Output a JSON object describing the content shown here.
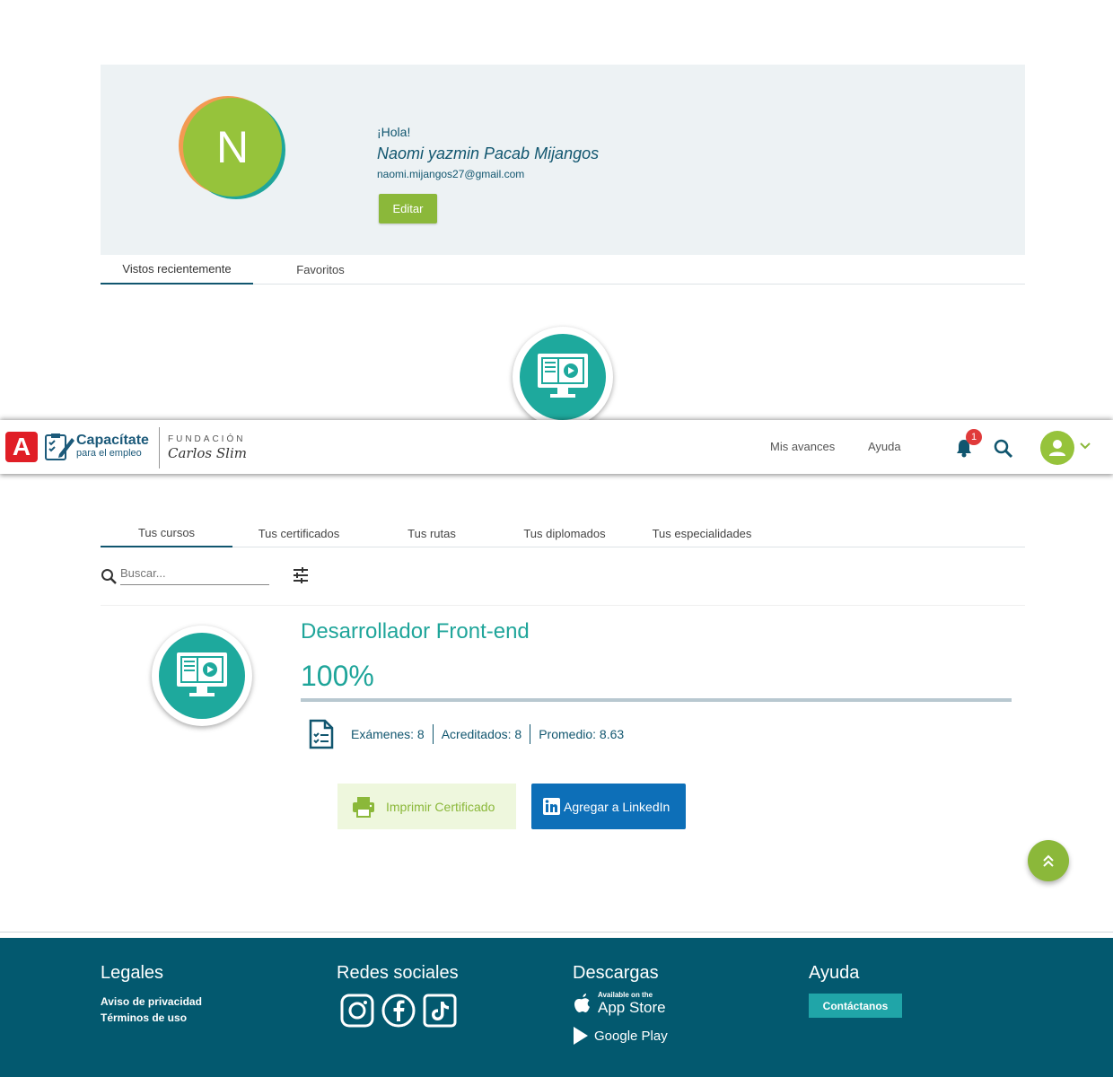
{
  "profile": {
    "avatar_letter": "N",
    "greeting": "¡Hola!",
    "name": "Naomi yazmin Pacab Mijangos",
    "email": "naomi.mijangos27@gmail.com",
    "edit_label": "Editar",
    "tabs": [
      "Vistos recientemente",
      "Favoritos"
    ]
  },
  "header": {
    "logo_letter": "A",
    "brand_title": "Capacítate",
    "brand_subtitle": "para el empleo",
    "foundation": "FUNDACIÓN",
    "foundation_name": "Carlos Slim",
    "nav": [
      "Mis avances",
      "Ayuda"
    ],
    "notification_count": "1"
  },
  "courses_tabs": [
    "Tus cursos",
    "Tus certificados",
    "Tus rutas",
    "Tus diplomados",
    "Tus especialidades"
  ],
  "search": {
    "placeholder": "Buscar..."
  },
  "course": {
    "title": "Desarrollador Front-end",
    "progress_label": "100%",
    "progress": 1.0,
    "exams": "Exámenes: 8",
    "accredited": "Acreditados: 8",
    "average": "Promedio: 8.63",
    "print_label": "Imprimir Certificado",
    "linkedin_label": "Agregar a LinkedIn"
  },
  "footer": {
    "legal_title": "Legales",
    "privacy": "Aviso de privacidad",
    "terms": "Términos de uso",
    "social_title": "Redes sociales",
    "downloads_title": "Descargas",
    "appstore_small": "Available on the",
    "appstore_big": "App Store",
    "googleplay": "Google Play",
    "help_title": "Ayuda",
    "contact_label": "Contáctanos"
  },
  "colors": {
    "teal": "#1fa59a",
    "green": "#8bb83a",
    "navy": "#11566f",
    "footer": "#03596f",
    "linkedin": "#0d6fb8"
  }
}
